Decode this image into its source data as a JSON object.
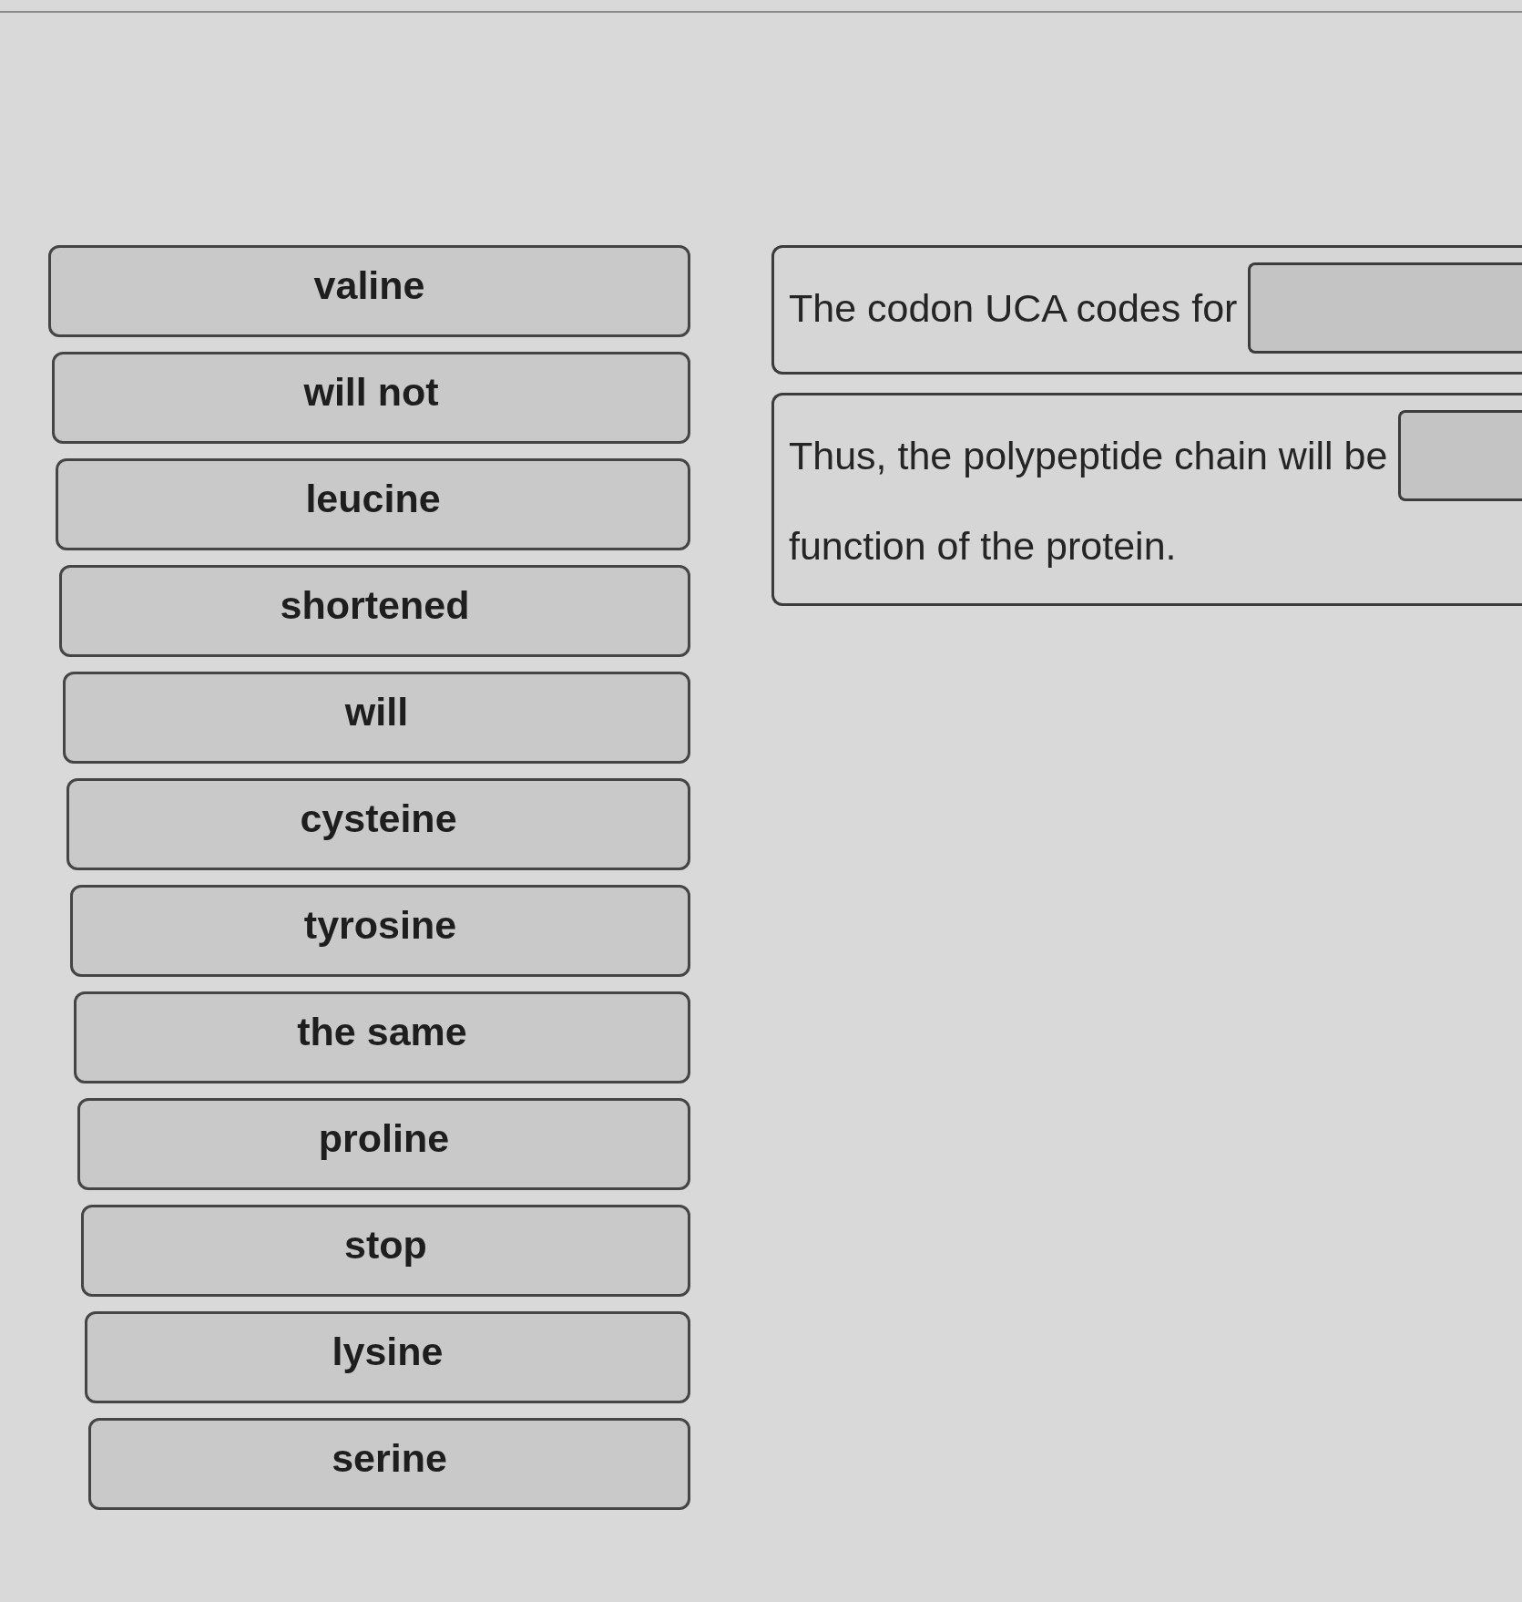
{
  "answer_bank": {
    "choices": [
      {
        "label": "valine"
      },
      {
        "label": "will not"
      },
      {
        "label": "leucine"
      },
      {
        "label": "shortened"
      },
      {
        "label": "will"
      },
      {
        "label": "cysteine"
      },
      {
        "label": "tyrosine"
      },
      {
        "label": "the same"
      },
      {
        "label": "proline"
      },
      {
        "label": "stop"
      },
      {
        "label": "lysine"
      },
      {
        "label": "serine"
      }
    ]
  },
  "statements": [
    {
      "parts": [
        {
          "kind": "text",
          "text": "The codon UCA codes for"
        },
        {
          "kind": "blank"
        }
      ]
    },
    {
      "parts": [
        {
          "kind": "text",
          "text": "Thus, the polypeptide chain will be"
        },
        {
          "kind": "blank"
        },
        {
          "kind": "text",
          "text": "function of the protein."
        }
      ]
    }
  ]
}
